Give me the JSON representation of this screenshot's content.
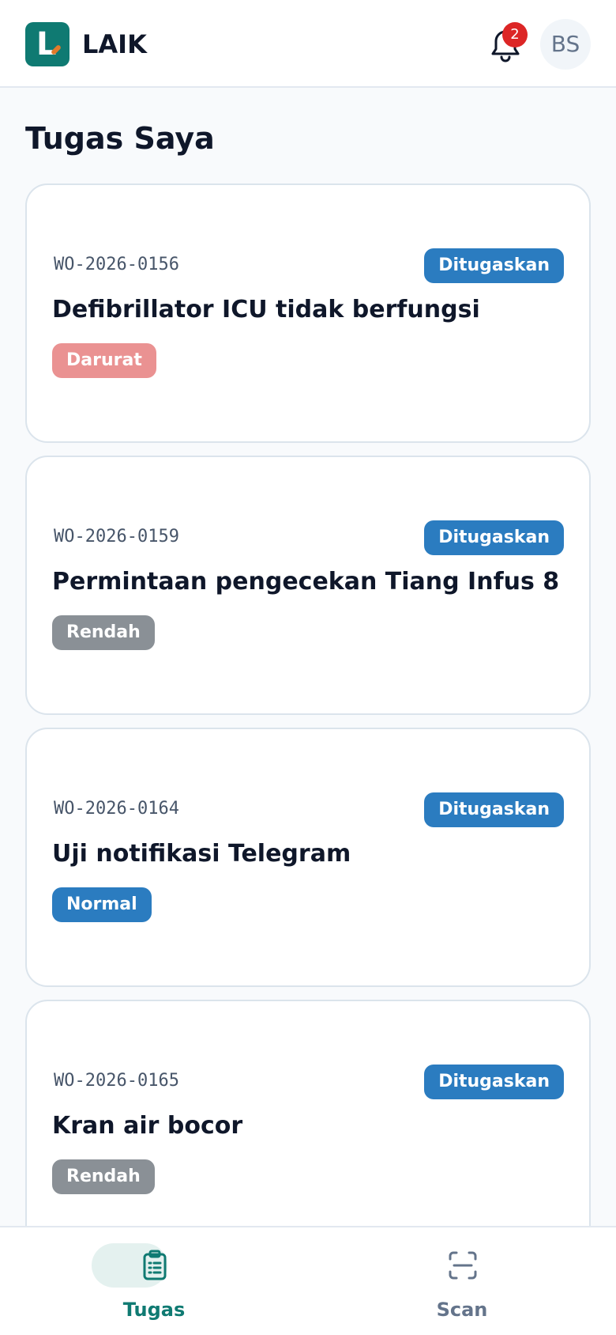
{
  "header": {
    "logo_letter": "L",
    "app_name": "LAIK",
    "notification_count": "2",
    "avatar_initials": "BS"
  },
  "page_title": "Tugas Saya",
  "tasks": [
    {
      "code": "WO-2026-0156",
      "status": "Ditugaskan",
      "title": "Defibrillator ICU tidak berfungsi",
      "priority": "Darurat",
      "priority_color": "#ea9292"
    },
    {
      "code": "WO-2026-0159",
      "status": "Ditugaskan",
      "title": "Permintaan pengecekan Tiang Infus 8",
      "priority": "Rendah",
      "priority_color": "#8a9096"
    },
    {
      "code": "WO-2026-0164",
      "status": "Ditugaskan",
      "title": "Uji notifikasi Telegram",
      "priority": "Normal",
      "priority_color": "#2b7cc0"
    },
    {
      "code": "WO-2026-0165",
      "status": "Ditugaskan",
      "title": "Kran air bocor",
      "priority": "Rendah",
      "priority_color": "#8a9096"
    }
  ],
  "nav": {
    "tasks_label": "Tugas",
    "scan_label": "Scan",
    "active": "tasks"
  },
  "colors": {
    "brand": "#0f7a72",
    "status": "#2b7cc0",
    "badge": "#dc2626",
    "active_nav": "#0f7a72",
    "inactive_nav": "#64748b"
  }
}
